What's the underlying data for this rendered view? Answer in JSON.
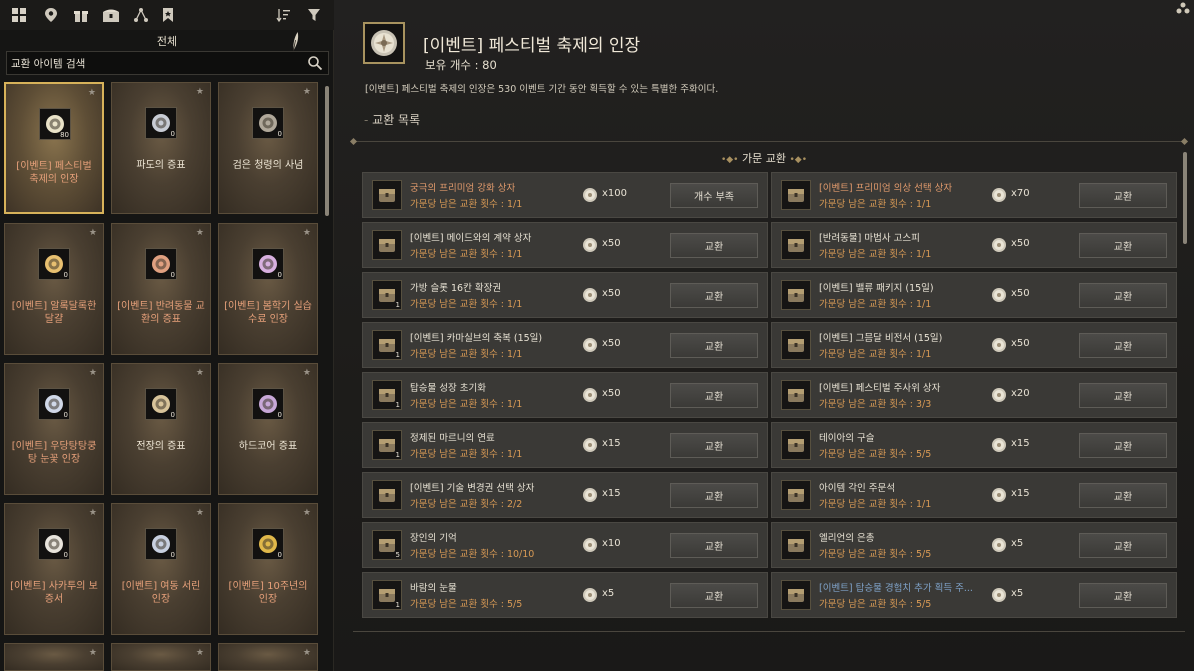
{
  "left_panel": {
    "category_title": "전체",
    "search": {
      "placeholder": "교환 아이템 검색",
      "value": "교환 아이템 검색"
    },
    "toolbar_icons": [
      "grid-icon",
      "pin-icon",
      "gift-icon",
      "chest-icon",
      "nodes-icon",
      "bookmark-icon",
      "sort-icon",
      "filter-icon"
    ],
    "cards": [
      {
        "name": "[이벤트] 페스티벌 축제의 인장",
        "count": "80",
        "event": true,
        "selected": true,
        "icon": "seal-icon",
        "color": "#e9e2c8"
      },
      {
        "name": "파도의 증표",
        "count": "0",
        "event": false,
        "icon": "wave-token-icon",
        "color": "#c8ccd4"
      },
      {
        "name": "검은 청령의 사념",
        "count": "0",
        "event": false,
        "icon": "dagger-icon",
        "color": "#b0a89a"
      },
      {
        "name": "[이벤트] 알록달록한 달걀",
        "count": "0",
        "event": true,
        "icon": "eggs-icon",
        "color": "#e8c070"
      },
      {
        "name": "[이벤트] 반려동물 교환의 증표",
        "count": "0",
        "event": true,
        "icon": "paw-token-icon",
        "color": "#e0a080"
      },
      {
        "name": "[이벤트] 봄학기 실습 수료 인장",
        "count": "0",
        "event": true,
        "icon": "flower-seal-icon",
        "color": "#d8b0e0"
      },
      {
        "name": "[이벤트] 우당탕탕쿵탕 눈꽃 인장",
        "count": "0",
        "event": true,
        "icon": "snow-seal-icon",
        "color": "#d0d8e8"
      },
      {
        "name": "전장의 증표",
        "count": "0",
        "event": false,
        "icon": "crossed-swords-icon",
        "color": "#d8c49a"
      },
      {
        "name": "하드코어 증표",
        "count": "0",
        "event": false,
        "icon": "bat-token-icon",
        "color": "#c8a8d8"
      },
      {
        "name": "[이벤트] 사카투의 보증서",
        "count": "0",
        "event": true,
        "icon": "certificate-icon",
        "color": "#e8e4dc"
      },
      {
        "name": "[이벤트] 여동 서린 인장",
        "count": "0",
        "event": true,
        "icon": "cloud-seal-icon",
        "color": "#c8d0e0"
      },
      {
        "name": "[이벤트] 10주년의 인장",
        "count": "0",
        "event": true,
        "icon": "gold-seal-icon",
        "color": "#e0b84a"
      }
    ]
  },
  "detail": {
    "title": "[이벤트] 페스티벌 축제의 인장",
    "owned_label": "보유 개수 : 80",
    "description": "[이벤트] 페스티벌 축제의 인장은 530 이벤트 기간 동안 획득할 수 있는 특별한 주화이다.",
    "list_title": "교환 목록",
    "section_title": "가문 교환"
  },
  "exchange_rows": [
    {
      "name": "궁극의 프리미엄 강화 상자",
      "limit": "가문당 남은 교환 횟수 : 1/1",
      "price": "x100",
      "button": "개수 부족",
      "style": "ev",
      "icon": "chest-icon",
      "icount": ""
    },
    {
      "name": "[이벤트] 프리미엄 의상 선택 상자",
      "limit": "가문당 남은 교환 횟수 : 1/1",
      "price": "x70",
      "button": "교환",
      "style": "ev",
      "icon": "costume-box-icon",
      "icount": ""
    },
    {
      "name": "[이벤트] 메이드와의 계약 상자",
      "limit": "가문당 남은 교환 횟수 : 1/1",
      "price": "x50",
      "button": "교환",
      "style": "",
      "icon": "treasure-chest-icon",
      "icount": ""
    },
    {
      "name": "[반려동물] 마법사 고스피",
      "limit": "가문당 남은 교환 횟수 : 1/1",
      "price": "x50",
      "button": "교환",
      "style": "",
      "icon": "wizard-hat-icon",
      "icount": ""
    },
    {
      "name": "가방 슬롯 16칸 확장권",
      "limit": "가문당 남은 교환 횟수 : 1/1",
      "price": "x50",
      "button": "교환",
      "style": "",
      "icon": "feather-icon",
      "icount": "1"
    },
    {
      "name": "[이벤트] 밸류 패키지 (15일)",
      "limit": "가문당 남은 교환 횟수 : 1/1",
      "price": "x50",
      "button": "교환",
      "style": "",
      "icon": "package-icon",
      "icount": ""
    },
    {
      "name": "[이벤트] 카마실브의 축복 (15일)",
      "limit": "가문당 남은 교환 횟수 : 1/1",
      "price": "x50",
      "button": "교환",
      "style": "",
      "icon": "tree-icon",
      "icount": "1"
    },
    {
      "name": "[이벤트] 그믐달 비전서 (15일)",
      "limit": "가문당 남은 교환 횟수 : 1/1",
      "price": "x50",
      "button": "교환",
      "style": "",
      "icon": "scroll-icon",
      "icount": ""
    },
    {
      "name": "탑승물 성장 초기화",
      "limit": "가문당 남은 교환 횟수 : 1/1",
      "price": "x50",
      "button": "교환",
      "style": "",
      "icon": "potion-icon",
      "icount": "1"
    },
    {
      "name": "[이벤트] 페스티벌 주사위 상자",
      "limit": "가문당 남은 교환 횟수 : 3/3",
      "price": "x20",
      "button": "교환",
      "style": "",
      "icon": "dice-box-icon",
      "icount": ""
    },
    {
      "name": "정제된 마르니의 연료",
      "limit": "가문당 남은 교환 횟수 : 1/1",
      "price": "x15",
      "button": "교환",
      "style": "",
      "icon": "fuel-icon",
      "icount": "1"
    },
    {
      "name": "테이아의 구슬",
      "limit": "가문당 남은 교환 횟수 : 5/5",
      "price": "x15",
      "button": "교환",
      "style": "",
      "icon": "orb-icon",
      "icount": ""
    },
    {
      "name": "[이벤트] 기술 변경권 선택 상자",
      "limit": "가문당 남은 교환 횟수 : 2/2",
      "price": "x15",
      "button": "교환",
      "style": "",
      "icon": "treasure-chest-icon",
      "icount": ""
    },
    {
      "name": "아이템 각인 주문석",
      "limit": "가문당 남은 교환 횟수 : 1/1",
      "price": "x15",
      "button": "교환",
      "style": "",
      "icon": "stone-icon",
      "icount": ""
    },
    {
      "name": "장인의 기억",
      "limit": "가문당 남은 교환 횟수 : 10/10",
      "price": "x10",
      "button": "교환",
      "style": "",
      "icon": "artisan-icon",
      "icount": "5"
    },
    {
      "name": "엘리언의 은총",
      "limit": "가문당 남은 교환 횟수 : 5/5",
      "price": "x5",
      "button": "교환",
      "style": "",
      "icon": "grace-icon",
      "icount": ""
    },
    {
      "name": "바람의 눈물",
      "limit": "가문당 남은 교환 횟수 : 5/5",
      "price": "x5",
      "button": "교환",
      "style": "",
      "icon": "tear-icon",
      "icount": "1"
    },
    {
      "name": "[이벤트] 탑승물 경험치 추가 획득 주...",
      "limit": "가문당 남은 교환 횟수 : 5/5",
      "price": "x5",
      "button": "교환",
      "style": "blue",
      "icon": "mount-scroll-icon",
      "icount": ""
    }
  ]
}
